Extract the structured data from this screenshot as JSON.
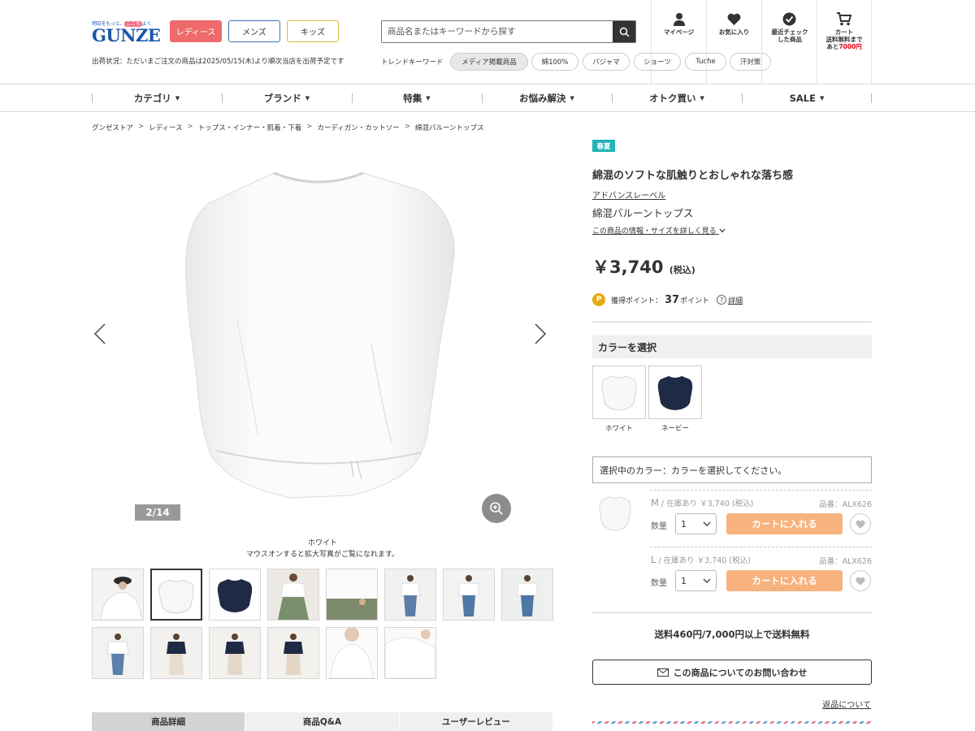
{
  "header": {
    "logo_tagline": "明日をもっと、ここちよく",
    "logo_tagline_highlight": "ここち",
    "logo_word": "GUNZE",
    "buttons": {
      "ladies": "レディース",
      "mens": "メンズ",
      "kids": "キッズ"
    },
    "ship_status": "出荷状況：ただいまご注文の商品は2025/05/15(木)より順次当店を出荷予定です",
    "search_placeholder": "商品名またはキーワードから探す",
    "trend_label": "トレンドキーワード",
    "trend_keywords": [
      "メディア掲載商品",
      "綿100%",
      "パジャマ",
      "ショーツ",
      "Tuche",
      "汗対策"
    ],
    "icons": {
      "mypage": "マイページ",
      "favorite": "お気に入り",
      "recent": "最近チェック した商品",
      "cart_title": "カート",
      "cart_note": "送料無料まで",
      "cart_remain_prefix": "あと",
      "cart_remain": "7000円"
    }
  },
  "nav": [
    "カテゴリ",
    "ブランド",
    "特集",
    "お悩み解決",
    "オトク買い",
    "SALE"
  ],
  "breadcrumb": [
    "グンゼストア",
    "レディース",
    "トップス・インナー・肌着・下着",
    "カーディガン・カットソー",
    "綿混バルーントップス"
  ],
  "gallery": {
    "counter": "2/14",
    "color_name": "ホワイト",
    "hint": "マウスオンすると拡大写真がご覧になれます。",
    "thumbs_row1": [
      "model-hat",
      "white",
      "navy",
      "model-green",
      "detail",
      "model-jeans",
      "model-jeans",
      "model-jeans"
    ],
    "thumbs_row2": [
      "model-jeans",
      "navy-model",
      "navy-model",
      "navy-model",
      "closeup",
      "closeup"
    ]
  },
  "tabs": [
    "商品詳細",
    "商品Q&A",
    "ユーザーレビュー"
  ],
  "product": {
    "season": "春夏",
    "catch": "綿混のソフトな肌触りとおしゃれな落ち感",
    "brand": "アドバンスレーベル",
    "name": "綿混バルーントップス",
    "detail_link": "この商品の情報・サイズを詳しく見る",
    "price": "￥3,740",
    "tax": "(税込)",
    "points_icon": "P",
    "points_label": "獲得ポイント：",
    "points_value": "37",
    "points_unit": "ポイント",
    "points_help": "詳細",
    "color_heading": "カラーを選択",
    "colors": [
      "ホワイト",
      "ネービー"
    ],
    "selected_color_text": "選択中のカラー：カラーを選択してください。",
    "skus": [
      {
        "size": "M",
        "stock": " / 在庫あり ￥3,740 (税込)",
        "code": "品番：ALX626",
        "qty_label": "数量",
        "qty": "1",
        "cart": "カートに入れる"
      },
      {
        "size": "L",
        "stock": " / 在庫あり ￥3,740 (税込)",
        "code": "品番：ALX626",
        "qty_label": "数量",
        "qty": "1",
        "cart": "カートに入れる"
      }
    ],
    "shipping_fee": "送料460円/7,000円以上で送料無料",
    "inquiry": "この商品についてのお問い合わせ",
    "return_link": "返品について"
  },
  "colors": {
    "accent_red": "#ef6b6b",
    "cart_orange": "#f7b27d",
    "badge_teal": "#22b3b9",
    "logo_blue": "#1a56a8",
    "navy": "#1f2a44"
  }
}
